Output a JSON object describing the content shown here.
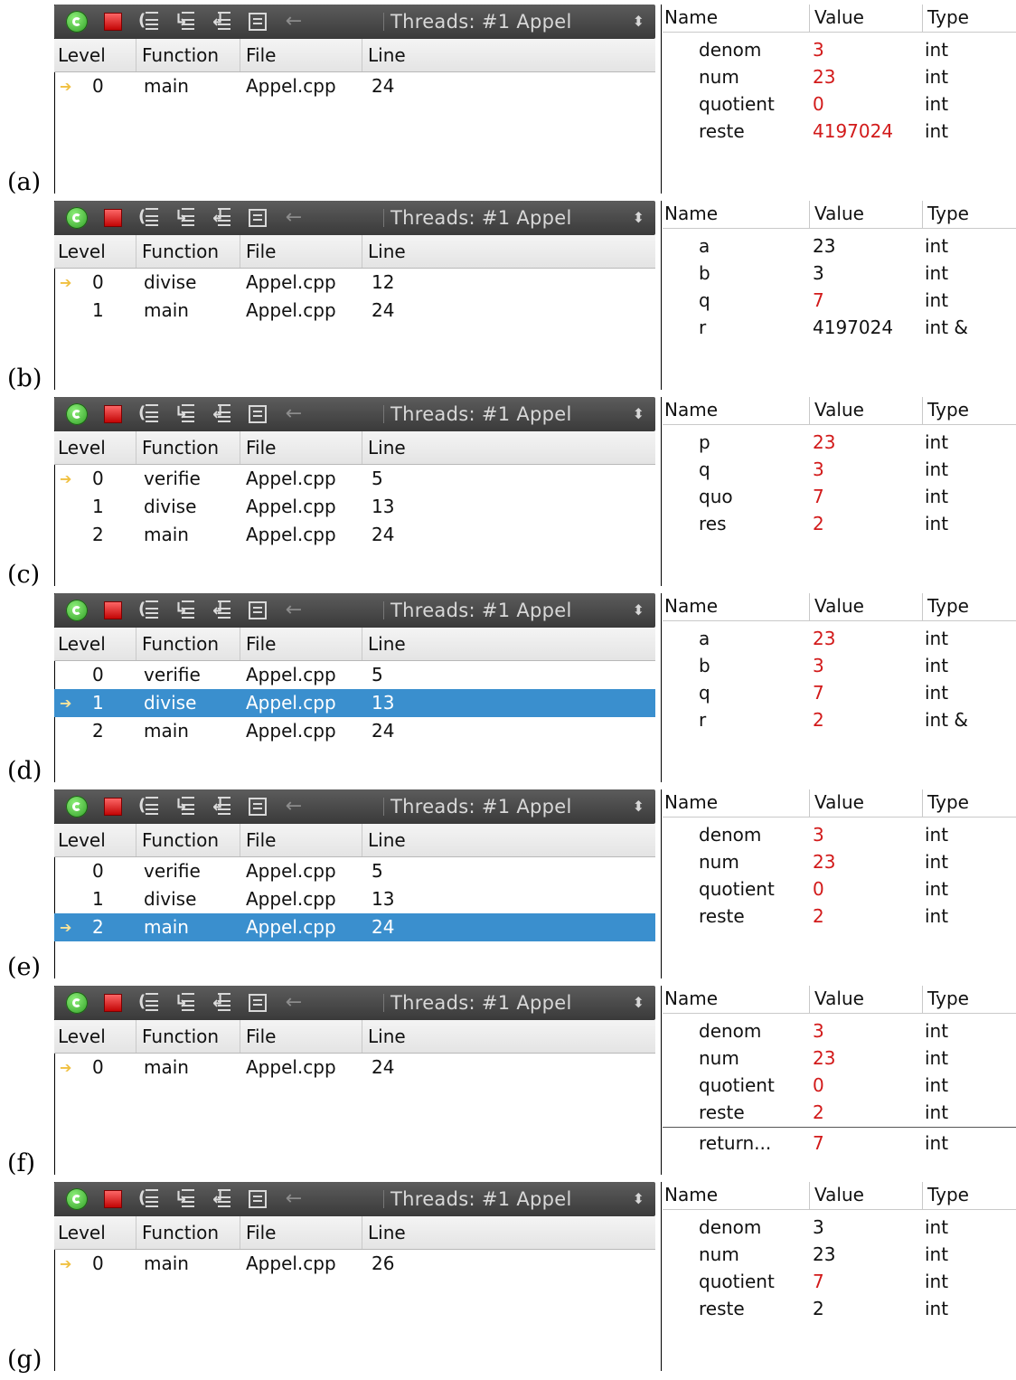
{
  "toolbar": {
    "threads_label": "Threads: #1 Appel",
    "spinner_glyph": "⬍"
  },
  "stack_headers": [
    "Level",
    "Function",
    "File",
    "Line"
  ],
  "locals_headers": [
    "Name",
    "Value",
    "Type"
  ],
  "panels": [
    {
      "label": "(a)",
      "stack": [
        {
          "level": "0",
          "function": "main",
          "file": "Appel.cpp",
          "line": "24",
          "current": true,
          "selected": false
        }
      ],
      "locals": [
        {
          "name": "denom",
          "value": "3",
          "type": "int",
          "changed": true
        },
        {
          "name": "num",
          "value": "23",
          "type": "int",
          "changed": true
        },
        {
          "name": "quotient",
          "value": "0",
          "type": "int",
          "changed": true
        },
        {
          "name": "reste",
          "value": "4197024",
          "type": "int",
          "changed": true
        }
      ],
      "return_row": null
    },
    {
      "label": "(b)",
      "stack": [
        {
          "level": "0",
          "function": "divise",
          "file": "Appel.cpp",
          "line": "12",
          "current": true,
          "selected": false
        },
        {
          "level": "1",
          "function": "main",
          "file": "Appel.cpp",
          "line": "24",
          "current": false,
          "selected": false
        }
      ],
      "locals": [
        {
          "name": "a",
          "value": "23",
          "type": "int",
          "changed": false
        },
        {
          "name": "b",
          "value": "3",
          "type": "int",
          "changed": false
        },
        {
          "name": "q",
          "value": "7",
          "type": "int",
          "changed": true
        },
        {
          "name": "r",
          "value": "4197024",
          "type": "int &",
          "changed": false
        }
      ],
      "return_row": null
    },
    {
      "label": "(c)",
      "stack": [
        {
          "level": "0",
          "function": "verifie",
          "file": "Appel.cpp",
          "line": "5",
          "current": true,
          "selected": false
        },
        {
          "level": "1",
          "function": "divise",
          "file": "Appel.cpp",
          "line": "13",
          "current": false,
          "selected": false
        },
        {
          "level": "2",
          "function": "main",
          "file": "Appel.cpp",
          "line": "24",
          "current": false,
          "selected": false
        }
      ],
      "locals": [
        {
          "name": "p",
          "value": "23",
          "type": "int",
          "changed": true
        },
        {
          "name": "q",
          "value": "3",
          "type": "int",
          "changed": true
        },
        {
          "name": "quo",
          "value": "7",
          "type": "int",
          "changed": true
        },
        {
          "name": "res",
          "value": "2",
          "type": "int",
          "changed": true
        }
      ],
      "return_row": null
    },
    {
      "label": "(d)",
      "stack": [
        {
          "level": "0",
          "function": "verifie",
          "file": "Appel.cpp",
          "line": "5",
          "current": false,
          "selected": false
        },
        {
          "level": "1",
          "function": "divise",
          "file": "Appel.cpp",
          "line": "13",
          "current": true,
          "selected": true
        },
        {
          "level": "2",
          "function": "main",
          "file": "Appel.cpp",
          "line": "24",
          "current": false,
          "selected": false
        }
      ],
      "locals": [
        {
          "name": "a",
          "value": "23",
          "type": "int",
          "changed": true
        },
        {
          "name": "b",
          "value": "3",
          "type": "int",
          "changed": true
        },
        {
          "name": "q",
          "value": "7",
          "type": "int",
          "changed": true
        },
        {
          "name": "r",
          "value": "2",
          "type": "int &",
          "changed": true
        }
      ],
      "return_row": null
    },
    {
      "label": "(e)",
      "stack": [
        {
          "level": "0",
          "function": "verifie",
          "file": "Appel.cpp",
          "line": "5",
          "current": false,
          "selected": false
        },
        {
          "level": "1",
          "function": "divise",
          "file": "Appel.cpp",
          "line": "13",
          "current": false,
          "selected": false
        },
        {
          "level": "2",
          "function": "main",
          "file": "Appel.cpp",
          "line": "24",
          "current": true,
          "selected": true
        }
      ],
      "locals": [
        {
          "name": "denom",
          "value": "3",
          "type": "int",
          "changed": true
        },
        {
          "name": "num",
          "value": "23",
          "type": "int",
          "changed": true
        },
        {
          "name": "quotient",
          "value": "0",
          "type": "int",
          "changed": true
        },
        {
          "name": "reste",
          "value": "2",
          "type": "int",
          "changed": true
        }
      ],
      "return_row": null
    },
    {
      "label": "(f)",
      "stack": [
        {
          "level": "0",
          "function": "main",
          "file": "Appel.cpp",
          "line": "24",
          "current": true,
          "selected": false
        }
      ],
      "locals": [
        {
          "name": "denom",
          "value": "3",
          "type": "int",
          "changed": true
        },
        {
          "name": "num",
          "value": "23",
          "type": "int",
          "changed": true
        },
        {
          "name": "quotient",
          "value": "0",
          "type": "int",
          "changed": true
        },
        {
          "name": "reste",
          "value": "2",
          "type": "int",
          "changed": true
        }
      ],
      "return_row": {
        "name": "return...",
        "value": "7",
        "type": "int",
        "changed": true
      }
    },
    {
      "label": "(g)",
      "stack": [
        {
          "level": "0",
          "function": "main",
          "file": "Appel.cpp",
          "line": "26",
          "current": true,
          "selected": false
        }
      ],
      "locals": [
        {
          "name": "denom",
          "value": "3",
          "type": "int",
          "changed": false
        },
        {
          "name": "num",
          "value": "23",
          "type": "int",
          "changed": false
        },
        {
          "name": "quotient",
          "value": "7",
          "type": "int",
          "changed": true
        },
        {
          "name": "reste",
          "value": "2",
          "type": "int",
          "changed": false
        }
      ],
      "return_row": null
    }
  ],
  "colors": {
    "changed_value": "#d21a1a",
    "selection": "#3a8fce",
    "current_frame_arrow": "#f0c040"
  },
  "icons": [
    "continue-icon",
    "stop-icon",
    "step-over-icon",
    "step-into-icon",
    "step-out-icon",
    "disassembly-icon",
    "back-icon",
    "threads-spinner-icon"
  ]
}
